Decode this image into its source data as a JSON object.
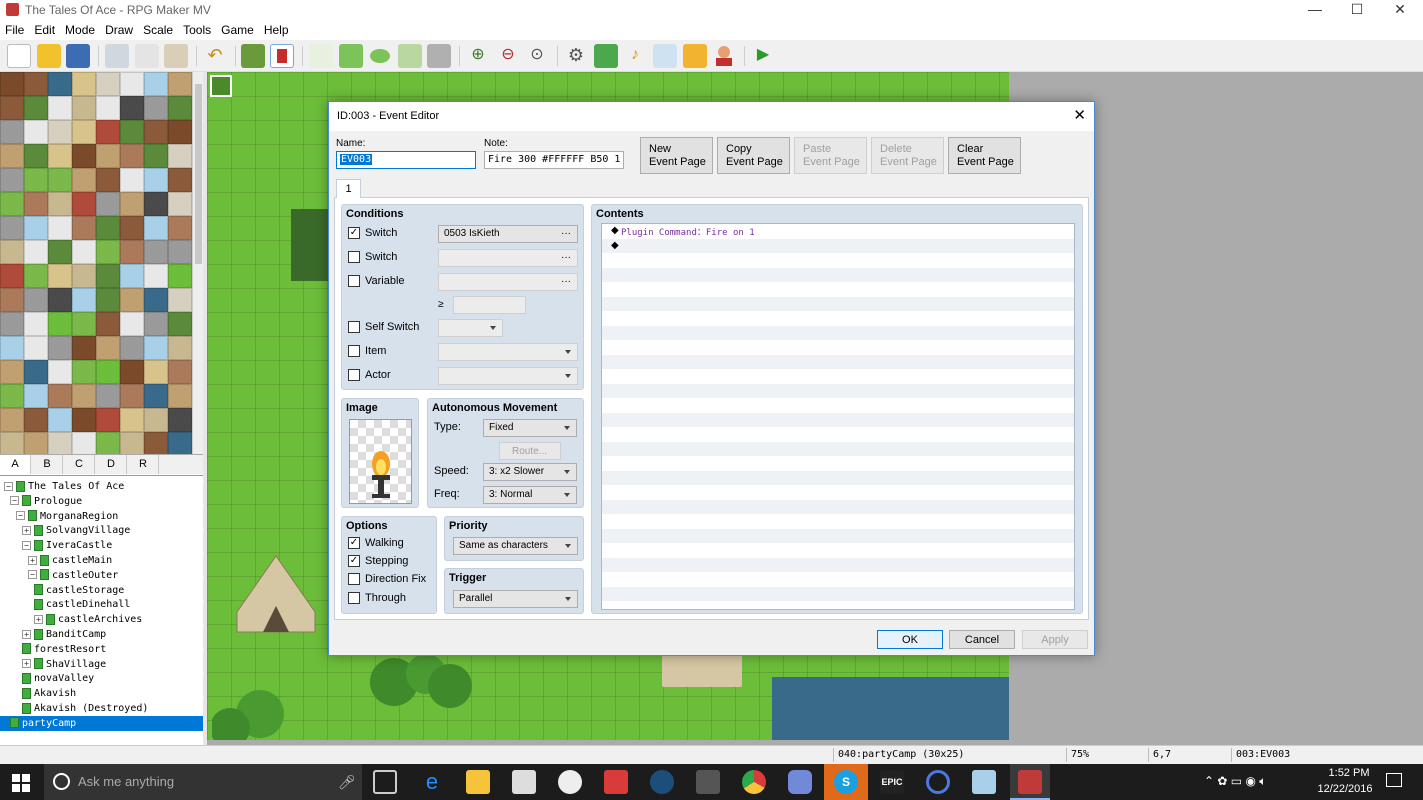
{
  "app": {
    "title": "The Tales Of Ace - RPG Maker MV",
    "controls": {
      "minimize": "—",
      "maximize": "☐",
      "close": "✕"
    }
  },
  "menu": [
    "File",
    "Edit",
    "Mode",
    "Draw",
    "Scale",
    "Tools",
    "Game",
    "Help"
  ],
  "toolbar": {
    "icons": [
      "new-project-icon",
      "open-project-icon",
      "save-project-icon",
      "cut-icon",
      "copy-icon",
      "paste-icon",
      "undo-icon",
      "map-mode-icon",
      "event-mode-icon",
      "pencil-icon",
      "rectangle-icon",
      "ellipse-icon",
      "fill-icon",
      "shadow-pen-icon",
      "zoom-in-icon",
      "zoom-out-icon",
      "zoom-actual-icon",
      "database-icon",
      "plugin-manager-icon",
      "sound-test-icon",
      "event-searcher-icon",
      "resource-manager-icon",
      "character-generator-icon",
      "playtest-icon"
    ]
  },
  "tileset_tabs": [
    "A",
    "B",
    "C",
    "D",
    "R"
  ],
  "map_tree": [
    {
      "label": "The Tales Of Ace",
      "indent": 0,
      "exp": "−",
      "root": true
    },
    {
      "label": "Prologue",
      "indent": 1,
      "exp": "−"
    },
    {
      "label": "MorganaRegion",
      "indent": 2,
      "exp": "−"
    },
    {
      "label": "SolvangVillage",
      "indent": 3,
      "exp": "+"
    },
    {
      "label": "IveraCastle",
      "indent": 3,
      "exp": "−"
    },
    {
      "label": "castleMain",
      "indent": 4,
      "exp": "+"
    },
    {
      "label": "castleOuter",
      "indent": 4,
      "exp": "−"
    },
    {
      "label": "castleStorage",
      "indent": 5,
      "exp": ""
    },
    {
      "label": "castleDinehall",
      "indent": 5,
      "exp": ""
    },
    {
      "label": "castleArchives",
      "indent": 5,
      "exp": "+"
    },
    {
      "label": "BanditCamp",
      "indent": 3,
      "exp": "+"
    },
    {
      "label": "forestResort",
      "indent": 3,
      "exp": ""
    },
    {
      "label": "ShaVillage",
      "indent": 3,
      "exp": "+"
    },
    {
      "label": "novaValley",
      "indent": 3,
      "exp": ""
    },
    {
      "label": "Akavish",
      "indent": 3,
      "exp": ""
    },
    {
      "label": "Akavish (Destroyed)",
      "indent": 3,
      "exp": ""
    },
    {
      "label": "partyCamp",
      "indent": 1,
      "exp": "",
      "selected": true
    }
  ],
  "status": {
    "map": "040:partyCamp (30x25)",
    "zoom": "75%",
    "coords": "6,7",
    "event": "003:EV003"
  },
  "dialog": {
    "title": "ID:003 - Event Editor",
    "name_label": "Name:",
    "name_value": "EV003",
    "note_label": "Note:",
    "note_value": "Fire 300 #FFFFFF B50 1",
    "page_buttons": [
      {
        "line1": "New",
        "line2": "Event Page",
        "enabled": true
      },
      {
        "line1": "Copy",
        "line2": "Event Page",
        "enabled": true
      },
      {
        "line1": "Paste",
        "line2": "Event Page",
        "enabled": false
      },
      {
        "line1": "Delete",
        "line2": "Event Page",
        "enabled": false
      },
      {
        "line1": "Clear",
        "line2": "Event Page",
        "enabled": true
      }
    ],
    "page_tab": "1",
    "conditions": {
      "title": "Conditions",
      "switch1": {
        "label": "Switch",
        "checked": true,
        "value": "0503 IsKieth"
      },
      "switch2": {
        "label": "Switch",
        "checked": false,
        "value": ""
      },
      "variable": {
        "label": "Variable",
        "checked": false,
        "value": ""
      },
      "gte": "≥",
      "self_switch": {
        "label": "Self Switch",
        "checked": false
      },
      "item": {
        "label": "Item",
        "checked": false
      },
      "actor": {
        "label": "Actor",
        "checked": false
      }
    },
    "image": {
      "title": "Image"
    },
    "movement": {
      "title": "Autonomous Movement",
      "type_label": "Type:",
      "type_value": "Fixed",
      "route_label": "Route...",
      "speed_label": "Speed:",
      "speed_value": "3: x2 Slower",
      "freq_label": "Freq:",
      "freq_value": "3: Normal"
    },
    "options": {
      "title": "Options",
      "items": [
        {
          "label": "Walking",
          "checked": true
        },
        {
          "label": "Stepping",
          "checked": true
        },
        {
          "label": "Direction Fix",
          "checked": false
        },
        {
          "label": "Through",
          "checked": false
        }
      ]
    },
    "priority": {
      "title": "Priority",
      "value": "Same as characters"
    },
    "trigger": {
      "title": "Trigger",
      "value": "Parallel"
    },
    "contents": {
      "title": "Contents",
      "rows": [
        {
          "prefix": "◆",
          "text": "Plugin Command：Fire on 1"
        },
        {
          "prefix": "◆",
          "text": ""
        }
      ]
    },
    "ok_label": "OK",
    "cancel_label": "Cancel",
    "apply_label": "Apply"
  },
  "taskbar": {
    "search_placeholder": "Ask me anything",
    "time": "1:52 PM",
    "date": "12/22/2016"
  }
}
